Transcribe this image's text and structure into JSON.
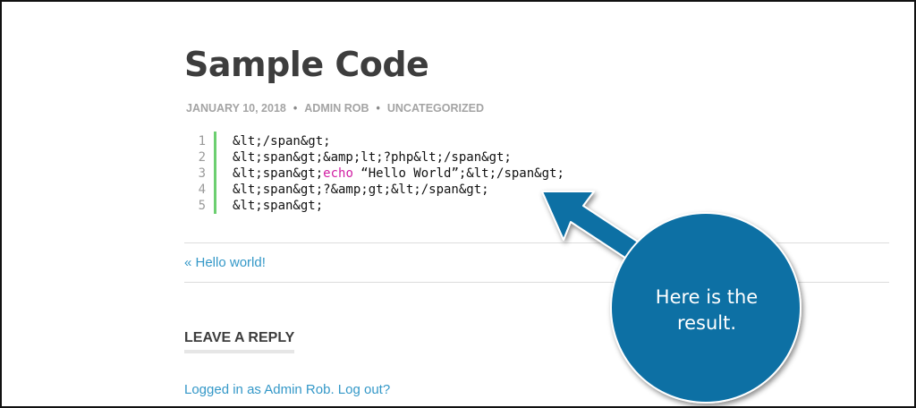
{
  "post": {
    "title": "Sample Code",
    "meta": {
      "date": "JANUARY 10, 2018",
      "author": "ADMIN ROB",
      "category": "UNCATEGORIZED",
      "separator": "•"
    },
    "code_lines": [
      {
        "number": "1",
        "text": "&lt;/span&gt;"
      },
      {
        "number": "2",
        "text": "&lt;span&gt;&amp;lt;?php&lt;/span&gt;"
      },
      {
        "number": "3",
        "prefix": "&lt;span&gt;",
        "keyword": "echo",
        "suffix": " “Hello World”;&lt;/span&gt;"
      },
      {
        "number": "4",
        "text": "&lt;span&gt;?&amp;gt;&lt;/span&gt;"
      },
      {
        "number": "5",
        "text": "&lt;span&gt;"
      }
    ]
  },
  "navigation": {
    "previous": "« Hello world!"
  },
  "comments": {
    "title": "LEAVE A REPLY",
    "logged_in_prefix": "Logged in as",
    "user": "Admin Rob",
    "period": ".",
    "logout": "Log out?"
  },
  "annotation": {
    "callout_line1": "Here is the",
    "callout_line2": "result.",
    "color": "#0b6fa4"
  }
}
